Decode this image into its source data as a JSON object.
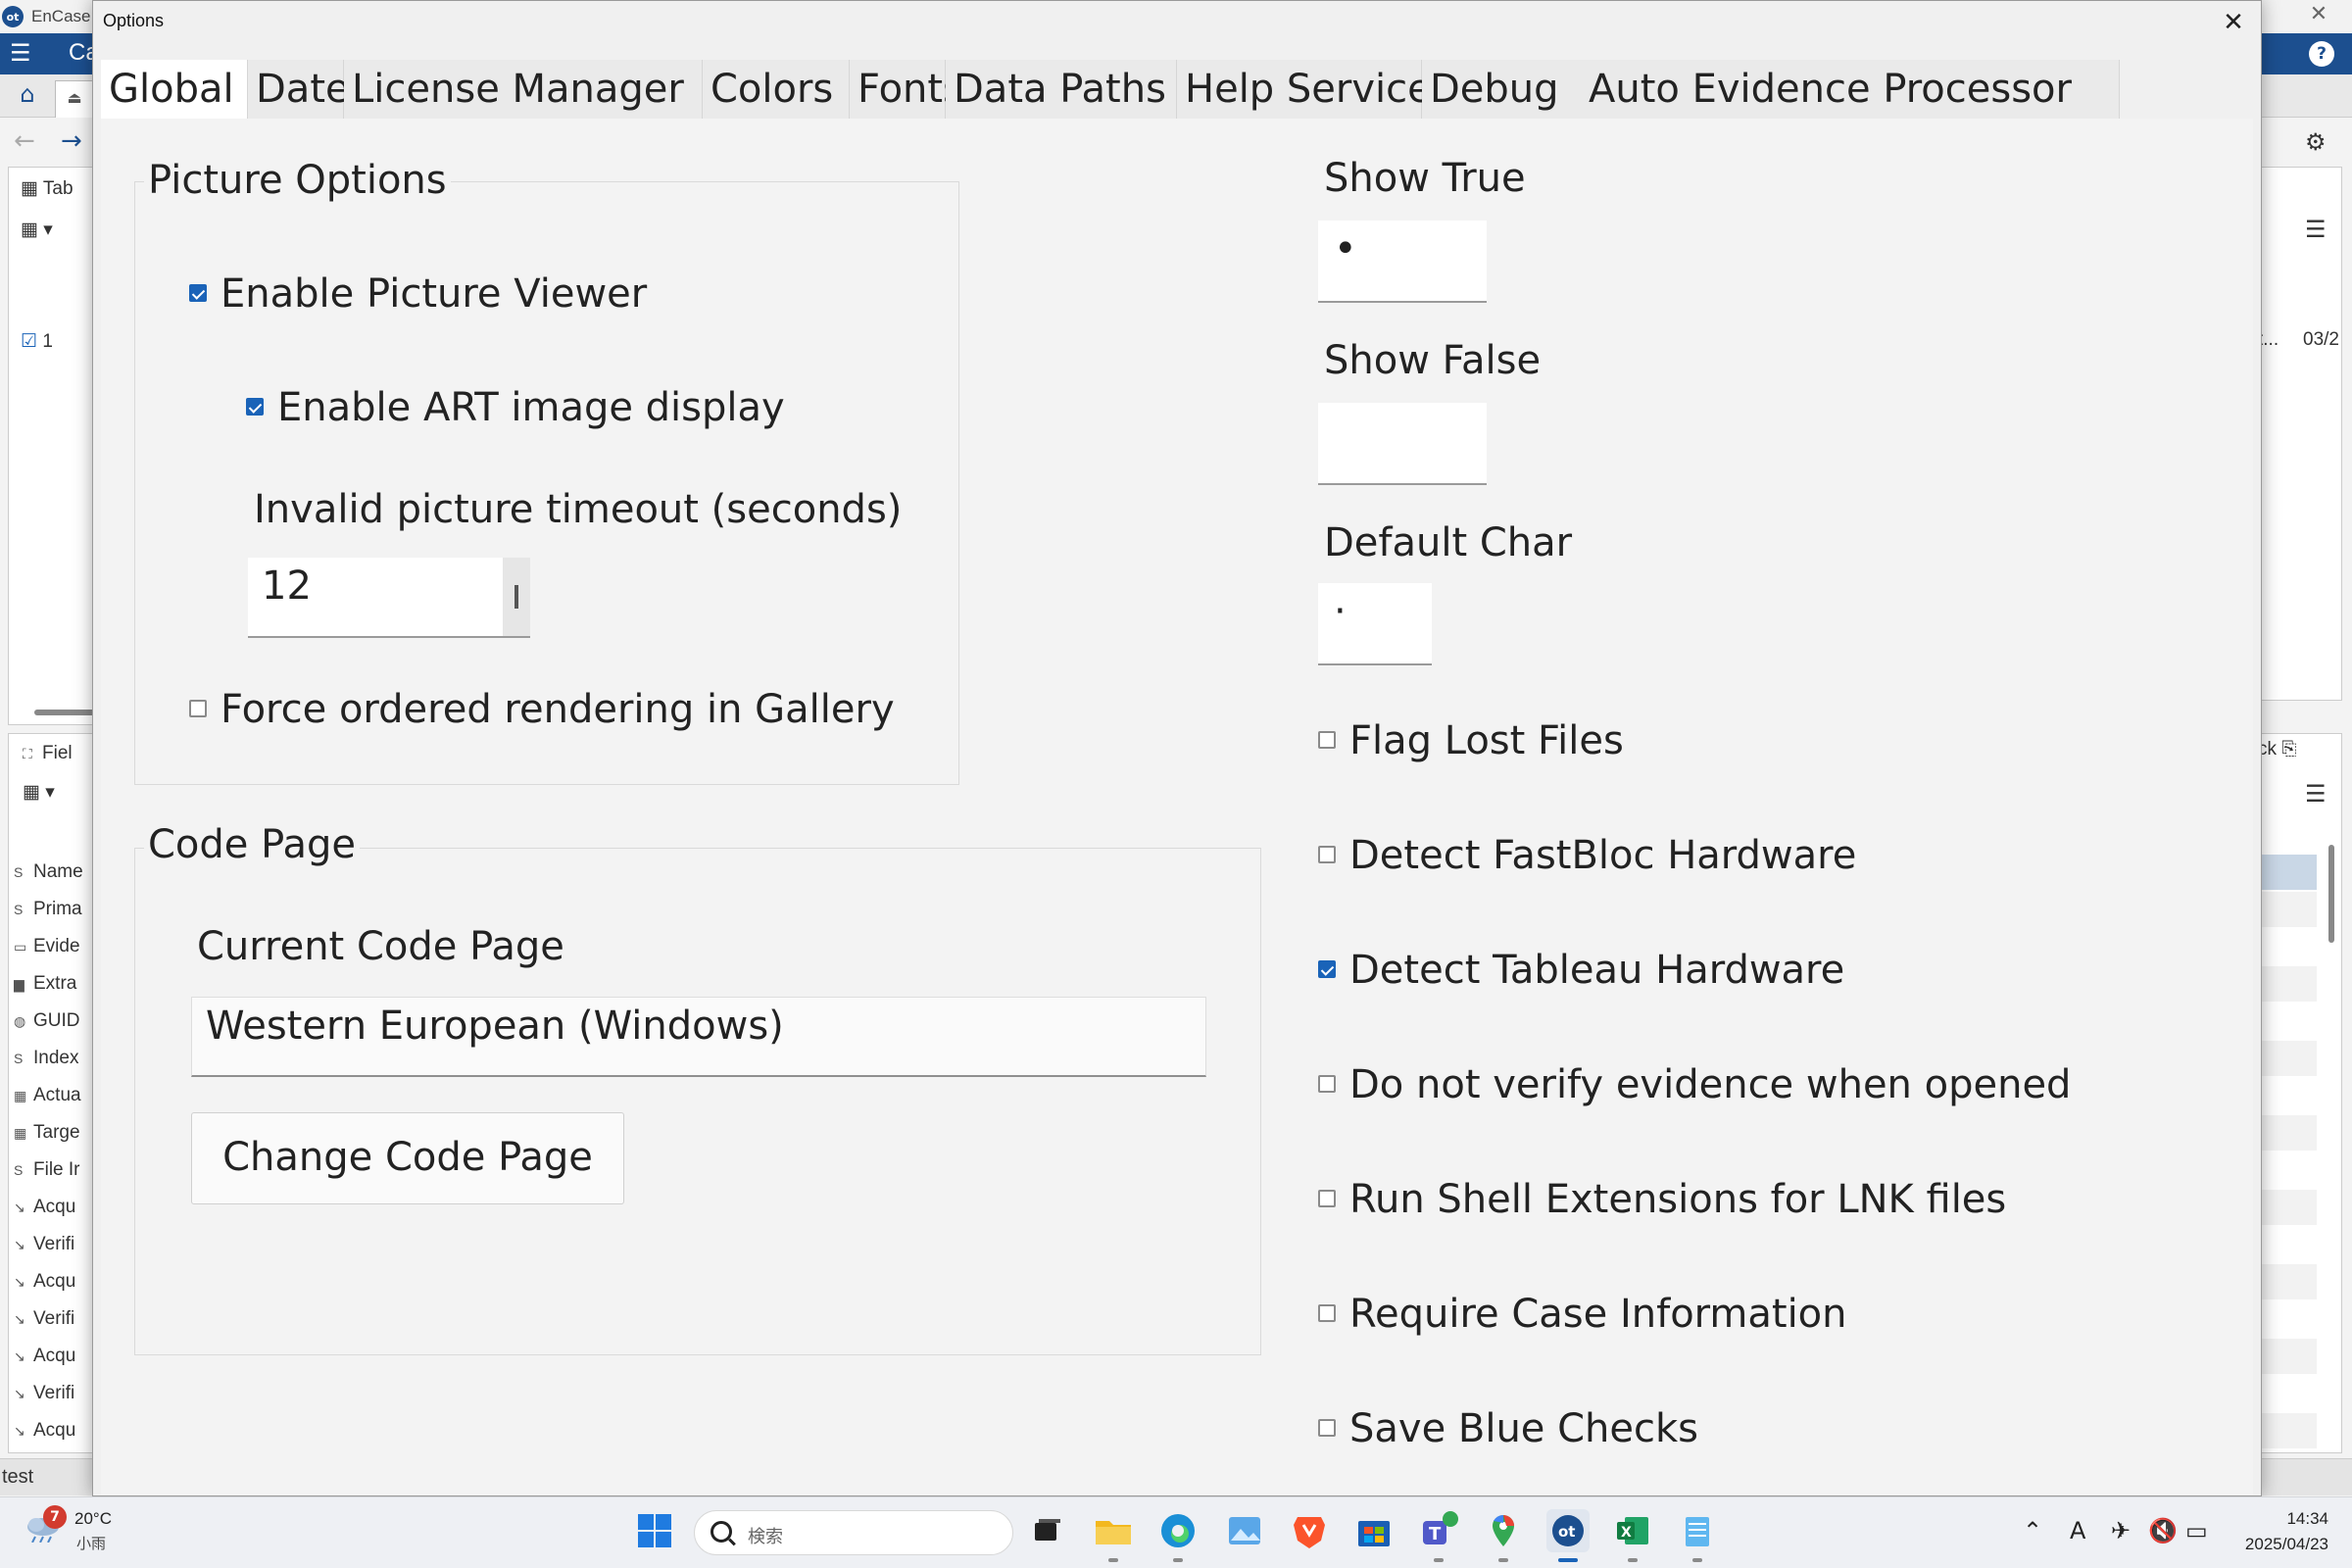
{
  "app": {
    "title": "EnCase",
    "menu_case": "Ca",
    "left_pane": {
      "tab_label": "Tab",
      "row_number": "1"
    },
    "fields_pane": {
      "title": "Fiel",
      "rows": [
        {
          "icon": "S",
          "label": "Name"
        },
        {
          "icon": "S",
          "label": "Prima"
        },
        {
          "icon": "▭",
          "label": "Evide"
        },
        {
          "icon": "▆",
          "label": "Extra"
        },
        {
          "icon": "◍",
          "label": "GUID"
        },
        {
          "icon": "S",
          "label": "Index"
        },
        {
          "icon": "▦",
          "label": "Actua"
        },
        {
          "icon": "▦",
          "label": "Targe"
        },
        {
          "icon": "S",
          "label": "File Ir"
        },
        {
          "icon": "↘",
          "label": "Acqu"
        },
        {
          "icon": "↘",
          "label": "Verifi"
        },
        {
          "icon": "↘",
          "label": "Acqu"
        },
        {
          "icon": "↘",
          "label": "Verifi"
        },
        {
          "icon": "↘",
          "label": "Acqu"
        },
        {
          "icon": "↘",
          "label": "Verifi"
        },
        {
          "icon": "↘",
          "label": "Acqu"
        }
      ]
    },
    "right_pane": {
      "date_fragment": "03/2",
      "dots": "t...",
      "lock_label": "ck"
    },
    "status_text": "test"
  },
  "dialog": {
    "title": "Options",
    "close_glyph": "✕",
    "tabs": [
      {
        "label": "Global",
        "active": true
      },
      {
        "label": "Date",
        "active": false
      },
      {
        "label": "License Manager",
        "active": false
      },
      {
        "label": "Colors",
        "active": false
      },
      {
        "label": "Fonts",
        "active": false
      },
      {
        "label": "Data Paths",
        "active": false
      },
      {
        "label": "Help Service",
        "active": false
      },
      {
        "label": "Debug",
        "active": false
      },
      {
        "label": "Auto Evidence Processor",
        "active": false
      }
    ],
    "picture_options": {
      "title": "Picture Options",
      "enable_picture_viewer": {
        "label": "Enable Picture Viewer",
        "checked": true
      },
      "enable_art": {
        "label": "Enable ART image display",
        "checked": true
      },
      "timeout_label": "Invalid picture timeout (seconds)",
      "timeout_value": "12",
      "force_ordered": {
        "label": "Force ordered rendering in Gallery",
        "checked": false
      }
    },
    "code_page": {
      "title": "Code Page",
      "current_label": "Current Code Page",
      "current_value": "Western European (Windows)",
      "change_button": "Change Code Page"
    },
    "right_column": {
      "show_true_label": "Show True",
      "show_true_value": "•",
      "show_false_label": "Show False",
      "show_false_value": "",
      "default_char_label": "Default Char",
      "default_char_value": "·",
      "checkboxes": [
        {
          "label": "Flag Lost Files",
          "checked": false
        },
        {
          "label": "Detect FastBloc Hardware",
          "checked": false
        },
        {
          "label": "Detect Tableau Hardware",
          "checked": true
        },
        {
          "label": "Do not verify evidence when opened",
          "checked": false
        },
        {
          "label": "Run Shell Extensions for LNK files",
          "checked": false
        },
        {
          "label": "Require Case Information",
          "checked": false
        },
        {
          "label": "Save Blue Checks",
          "checked": false
        }
      ]
    }
  },
  "taskbar": {
    "weather_badge": "7",
    "weather_temp": "20°C",
    "weather_condition": "小雨",
    "search_placeholder": "検索",
    "tray_text_icon": "A",
    "time": "14:34",
    "date": "2025/04/23",
    "colors": {
      "accent": "#1a63b8",
      "encase_blue": "#1c4f8f"
    }
  }
}
